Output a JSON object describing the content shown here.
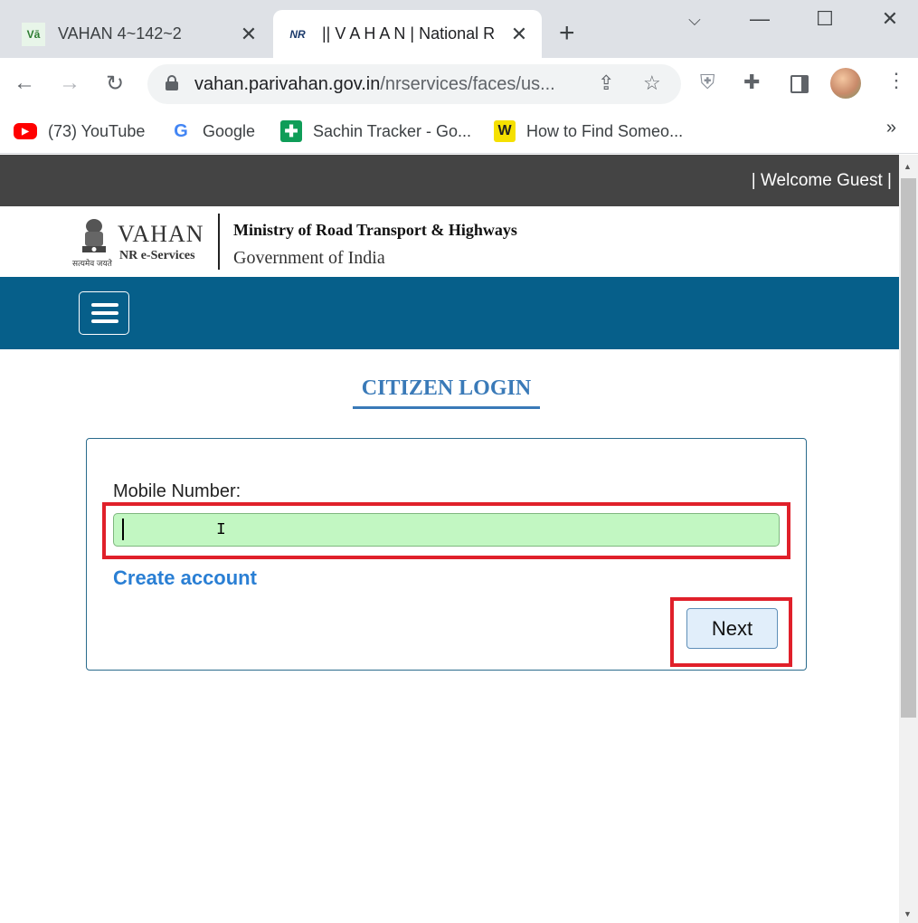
{
  "browser": {
    "tabs": [
      {
        "title": "VAHAN 4~142~2",
        "favicon_text": "Vā",
        "active": false
      },
      {
        "title": "|| V A H A N | National R",
        "favicon_text": "NR",
        "active": true
      }
    ],
    "new_tab_glyph": "+",
    "window_controls": {
      "minimize": "—",
      "maximize": "☐",
      "close": "✕"
    },
    "url_host": "vahan.parivahan.gov.in",
    "url_path": "/nrservices/faces/us...",
    "bookmarks": [
      {
        "label": "(73) YouTube",
        "icon": "youtube-icon",
        "color": "#ff0000"
      },
      {
        "label": "Google",
        "icon": "google-icon",
        "color": "#4285f4"
      },
      {
        "label": "Sachin Tracker - Go...",
        "icon": "sheets-icon",
        "color": "#0f9d58"
      },
      {
        "label": "How to Find Someo...",
        "icon": "w-icon",
        "color": "#f5e000"
      }
    ],
    "bookmarks_more": "»"
  },
  "header": {
    "welcome": "| Welcome Guest |",
    "logo_title": "VAHAN",
    "logo_subtitle": "NR e-Services",
    "emblem_motto": "सत्यमेव जयते",
    "ministry": "Ministry of Road Transport & Highways",
    "government": "Government of India"
  },
  "login": {
    "title": "CITIZEN LOGIN",
    "mobile_label": "Mobile Number:",
    "mobile_value": "",
    "create_account": "Create account",
    "next_label": "Next"
  },
  "colors": {
    "navbar": "#065f8a",
    "title_blue": "#3a7ab8",
    "input_bg": "#c2f7c2",
    "highlight_red": "#e0202a",
    "link_blue": "#2a7fd4"
  }
}
